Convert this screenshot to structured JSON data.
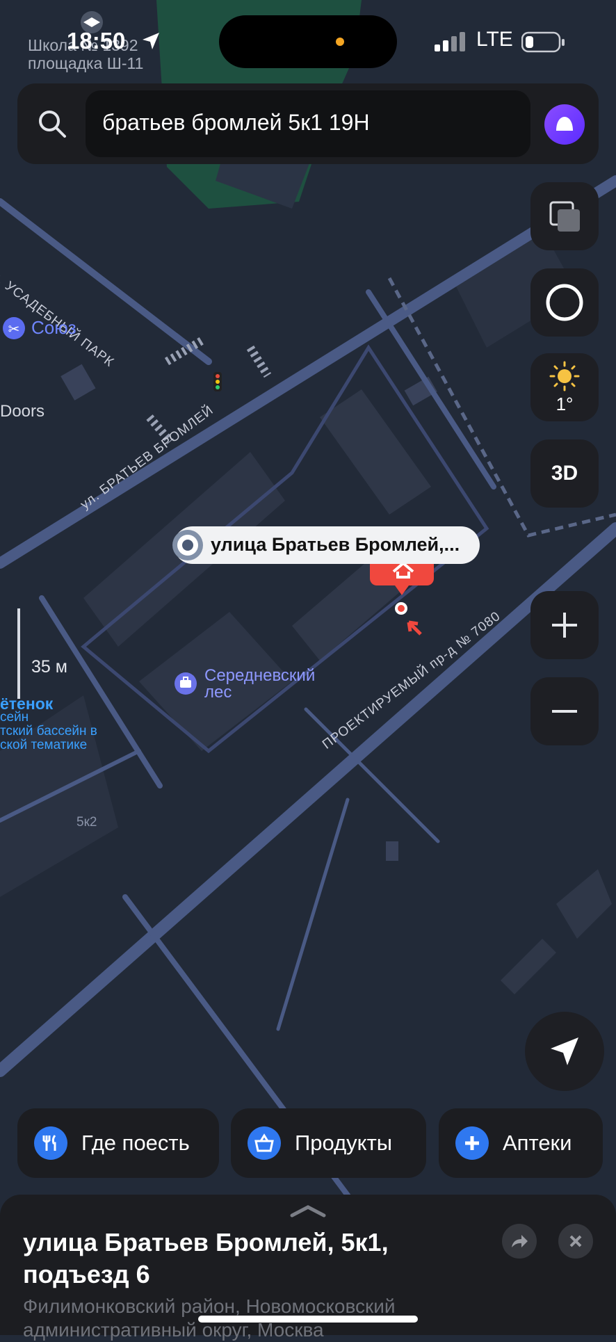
{
  "status_bar": {
    "time": "18:50",
    "network": "LTE",
    "school_poi_line1": "Школа № 1392",
    "school_poi_line2": "площадка Ш-11"
  },
  "search": {
    "query": "братьев бромлей 5к1 19Н"
  },
  "map": {
    "street_labels": {
      "usadebny": "ул. УСАДЕБНЫЙ ПАРК",
      "bratev": "ул. БРАТЬЕВ БРОМЛЕЙ",
      "proektiruemy": "ПРОЕКТИРУЕМЫЙ пр-д № 7080"
    },
    "poi": {
      "soyuz": "Союз",
      "doors": "Doors",
      "serednevsky_line1": "Середневский",
      "serednevsky_line2": "лес",
      "kotenok_line1": "ётенок",
      "kotenok_line2": "сейн",
      "kotenok_line3": "тский бассейн в",
      "kotenok_line4": "ской тематике",
      "building": "5к2"
    },
    "address_callout": "улица Братьев Бромлей,...",
    "scale_label": "35 м",
    "weather_temp": "1°",
    "mode_3d": "3D"
  },
  "chips": [
    {
      "label": "Где поесть",
      "icon": "fork-knife-icon"
    },
    {
      "label": "Продукты",
      "icon": "basket-icon"
    },
    {
      "label": "Аптеки",
      "icon": "pharmacy-cross-icon"
    }
  ],
  "sheet": {
    "title_line1": "улица Братьев Бромлей, 5к1,",
    "title_line2": "подъезд 6",
    "subtitle_line1": "Филимонковский район, Новомосковский",
    "subtitle_line2": "административный округ, Москва"
  },
  "colors": {
    "map_bg": "#222a38",
    "road": "#4a5a85",
    "accent_blue": "#2f78f0",
    "marker_red": "#f0483e",
    "park_green": "#1d6b46"
  }
}
